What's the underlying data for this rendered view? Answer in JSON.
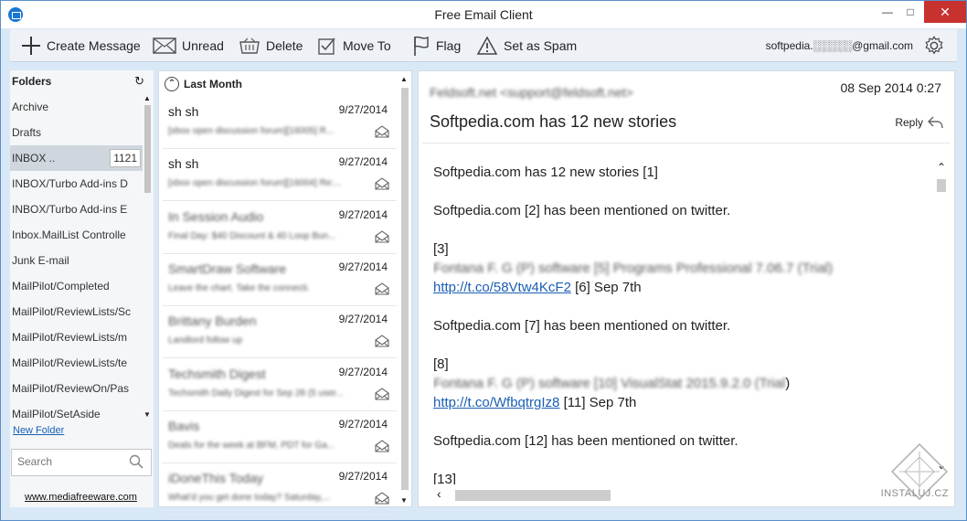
{
  "window": {
    "title": "Free Email Client"
  },
  "toolbar": {
    "create": "Create Message",
    "unread": "Unread",
    "delete": "Delete",
    "move": "Move To",
    "flag": "Flag",
    "spam": "Set as Spam",
    "account": "softpedia.░░░░░@gmail.com"
  },
  "folders": {
    "header": "Folders",
    "items": [
      {
        "label": "Archive"
      },
      {
        "label": "Drafts"
      },
      {
        "label": "INBOX ..",
        "count": "1121"
      },
      {
        "label": "INBOX/Turbo Add-ins D"
      },
      {
        "label": "INBOX/Turbo Add-ins E"
      },
      {
        "label": "Inbox.MailList Controlle"
      },
      {
        "label": "Junk E-mail"
      },
      {
        "label": "MailPilot/Completed"
      },
      {
        "label": "MailPilot/ReviewLists/Sc"
      },
      {
        "label": "MailPilot/ReviewLists/m"
      },
      {
        "label": "MailPilot/ReviewLists/te"
      },
      {
        "label": "MailPilot/ReviewOn/Pas"
      },
      {
        "label": "MailPilot/SetAside"
      }
    ],
    "new_folder": "New Folder",
    "search_placeholder": "Search",
    "site_link": "www.mediafreeware.com"
  },
  "messages": {
    "group": "Last Month",
    "items": [
      {
        "from": "sh sh",
        "date": "9/27/2014",
        "preview": "[xbox open discussion forum][16005] R...",
        "blur_from": false
      },
      {
        "from": "sh sh",
        "date": "9/27/2014",
        "preview": "[xbox open discussion forum][16004] Re:...",
        "blur_from": false
      },
      {
        "from": "In Session Audio",
        "date": "9/27/2014",
        "preview": "Final Day: $40 Discount & 40 Loop Bun...",
        "blur_from": true
      },
      {
        "from": "SmartDraw Software",
        "date": "9/27/2014",
        "preview": "Leave the chart. Take the connecti.",
        "blur_from": true
      },
      {
        "from": "Brittany Burden",
        "date": "9/27/2014",
        "preview": "Landlord follow up",
        "blur_from": true
      },
      {
        "from": "Techsmith Digest",
        "date": "9/27/2014",
        "preview": "Techsmith Daily Digest for Sep 28 (5 user...",
        "blur_from": true
      },
      {
        "from": "Bavis",
        "date": "9/27/2014",
        "preview": "Deals for the week at BFM, PDT for Ga...",
        "blur_from": true
      },
      {
        "from": "iDoneThis Today",
        "date": "9/27/2014",
        "preview": "What'd you get done today? Saturday,...",
        "blur_from": true
      }
    ]
  },
  "reader": {
    "from": "Feldsoft.net <support@feldsoft.net>",
    "date": "08 Sep 2014 0:27",
    "subject": "Softpedia.com has 12 new stories",
    "reply": "Reply",
    "body": {
      "l1": "Softpedia.com has 12 new stories [1]",
      "l2": "Softpedia.com [2] has been mentioned on twitter.",
      "l3": "[3]",
      "l4": "Fontana F. G (P) software [5] Programs Professional 7.06.7 (Trial)",
      "link1": "http://t.co/58Vtw4KcF2",
      "l5": " [6] Sep 7th",
      "l6": "Softpedia.com [7] has been mentioned on twitter.",
      "l7": "[8]",
      "l8": "Fontana F. G (P) software [10] VisualStat 2015.9.2.0 (Trial",
      "l8b": ")",
      "link2": "http://t.co/WfbqtrgIz8",
      "l9": " [11] Sep 7th",
      "l10": "Softpedia.com [12] has been mentioned on twitter.",
      "l11": "[13]"
    },
    "watermark": "INSTALUJ.CZ"
  }
}
